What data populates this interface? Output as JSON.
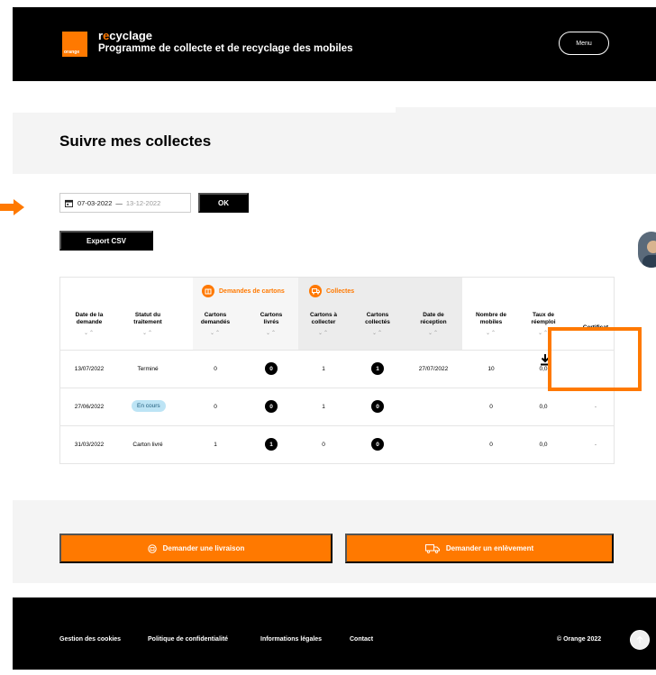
{
  "header": {
    "logo_text": "orange",
    "brand_prefix": "r",
    "brand_o": "e",
    "brand_suffix": "cyclage",
    "subtitle": "Programme de collecte et de recyclage des mobiles",
    "menu_label": "Menu"
  },
  "page": {
    "title": "Suivre mes collectes"
  },
  "filter": {
    "date_from": "07-03-2022",
    "separator": "—",
    "date_to": "13-12-2022",
    "ok_label": "OK",
    "export_label": "Export CSV"
  },
  "table": {
    "groups": {
      "demandes": "Demandes de cartons",
      "collectes": "Collectes"
    },
    "columns": [
      "Date de la demande",
      "Statut du traitement",
      "Cartons demandés",
      "Cartons livrés",
      "Cartons à collecter",
      "Cartons collectés",
      "Date de réception",
      "Nombre de mobiles",
      "Taux de réemploi",
      "Certificat"
    ],
    "rows": [
      {
        "date": "13/07/2022",
        "statut": "Terminé",
        "demandes": "0",
        "livres": "0",
        "a_collecter": "1",
        "collectes": "1",
        "reception": "27/07/2022",
        "mobiles": "10",
        "taux": "0,0",
        "certificat": ""
      },
      {
        "date": "27/06/2022",
        "statut": "En cours",
        "demandes": "0",
        "livres": "0",
        "a_collecter": "1",
        "collectes": "0",
        "reception": "",
        "mobiles": "0",
        "taux": "0,0",
        "certificat": "-"
      },
      {
        "date": "31/03/2022",
        "statut": "Carton livré",
        "demandes": "1",
        "livres": "1",
        "a_collecter": "0",
        "collectes": "0",
        "reception": "",
        "mobiles": "0",
        "taux": "0,0",
        "certificat": "-"
      }
    ]
  },
  "actions": {
    "livraison": "Demander une livraison",
    "enlevement": "Demander un enlèvement"
  },
  "footer": {
    "links": [
      "Gestion des cookies",
      "Politique de confidentialité",
      "Informations légales",
      "Contact"
    ],
    "copyright": "© Orange 2022"
  },
  "colors": {
    "accent": "#ff7900",
    "dark": "#000000",
    "band": "#f4f4f4"
  }
}
